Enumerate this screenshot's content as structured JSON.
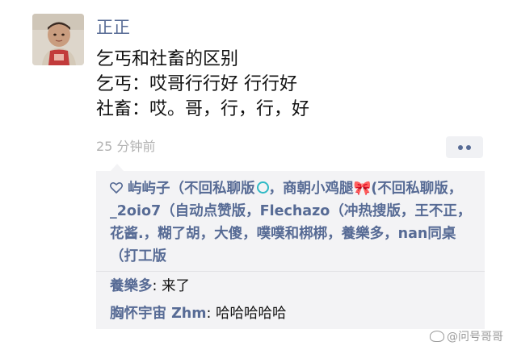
{
  "post": {
    "author": "正正",
    "lines": [
      "乞丐和社畜的区别",
      "乞丐：哎哥行行好 行行好",
      "社畜：哎。哥，行，行，好"
    ],
    "time": "25 分钟前"
  },
  "likes": {
    "segments": [
      "屿屿子（不回私聊版",
      "，商朝小鸡腿",
      "(不回私聊版，_2oio7（自动点赞版，Flechazo（冲热搜版，王不正，花酱.，糊了胡，大傻，噗噗和梆梆，養樂多，nan同桌（打工版"
    ]
  },
  "comments": [
    {
      "name": "養樂多",
      "sep": ": ",
      "text": "来了"
    },
    {
      "name": "胸怀宇宙 Zhm",
      "sep": ": ",
      "text": "哈哈哈哈哈"
    }
  ],
  "watermark": "@问号哥哥",
  "colors": {
    "link": "#576b95",
    "time": "#b2b2b2",
    "panel_bg": "#f3f3f5",
    "text": "#111111"
  },
  "icons": {
    "more": "more-dots-icon",
    "like": "heart-outline-icon"
  }
}
